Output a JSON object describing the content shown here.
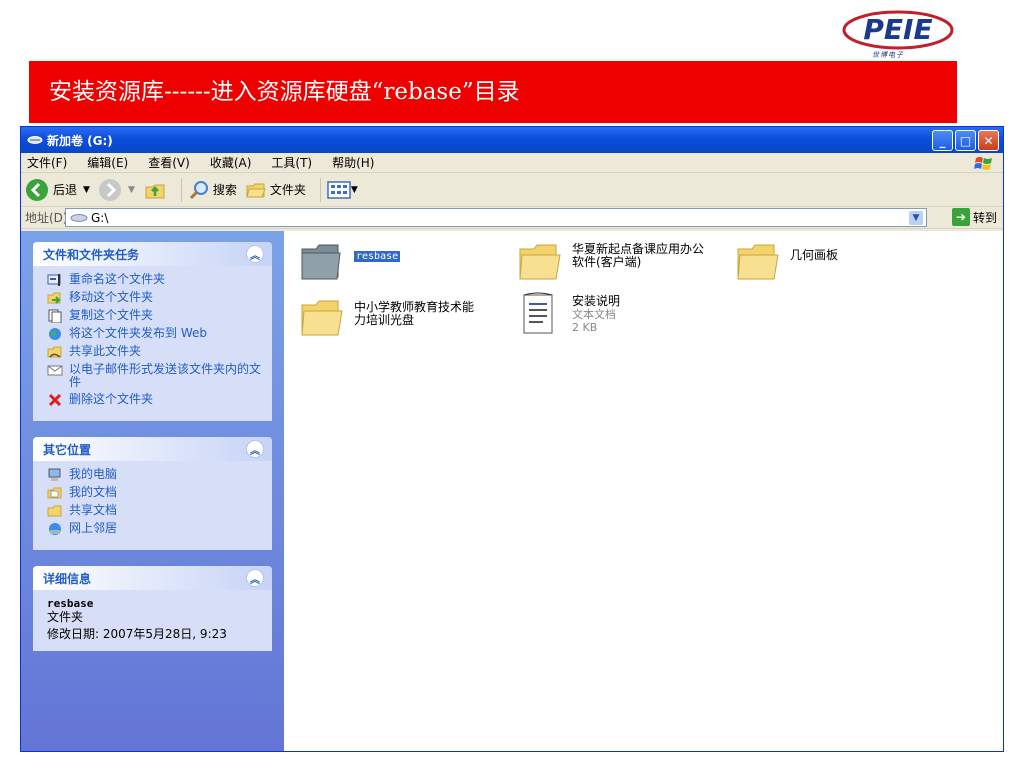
{
  "logo": {
    "text": "PEIE",
    "sub": "世博电子"
  },
  "banner": {
    "title": "安装资源库------进入资源库硬盘“rebase”目录"
  },
  "window": {
    "title": "新加卷 (G:)",
    "menu": [
      "文件(F)",
      "编辑(E)",
      "查看(V)",
      "收藏(A)",
      "工具(T)",
      "帮助(H)"
    ],
    "toolbar": {
      "back": "后退",
      "search": "搜索",
      "folders": "文件夹"
    },
    "address": {
      "label": "地址(D)",
      "value": "G:\\",
      "go": "转到"
    }
  },
  "taskpane": {
    "file_tasks": {
      "title": "文件和文件夹任务",
      "items": [
        "重命名这个文件夹",
        "移动这个文件夹",
        "复制这个文件夹",
        "将这个文件夹发布到 Web",
        "共享此文件夹",
        "以电子邮件形式发送该文件夹内的文件",
        "删除这个文件夹"
      ]
    },
    "other_places": {
      "title": "其它位置",
      "items": [
        "我的电脑",
        "我的文档",
        "共享文档",
        "网上邻居"
      ]
    },
    "details": {
      "title": "详细信息",
      "name": "resbase",
      "type": "文件夹",
      "modified": "修改日期: 2007年5月28日, 9:23"
    }
  },
  "files": [
    {
      "name": "resbase",
      "kind": "folder"
    },
    {
      "name": "华夏新起点备课应用办公软件(客户端)",
      "kind": "folder"
    },
    {
      "name": "几何画板",
      "kind": "folder"
    },
    {
      "name": "中小学教师教育技术能力培训光盘",
      "kind": "folder"
    },
    {
      "name": "安装说明",
      "kind": "text",
      "type": "文本文档",
      "size": "2 KB"
    }
  ],
  "colors": {
    "banner": "#ee0000",
    "titlebar": "#0a4ed8",
    "taskpane": "#6375d6",
    "link": "#215dc6"
  }
}
